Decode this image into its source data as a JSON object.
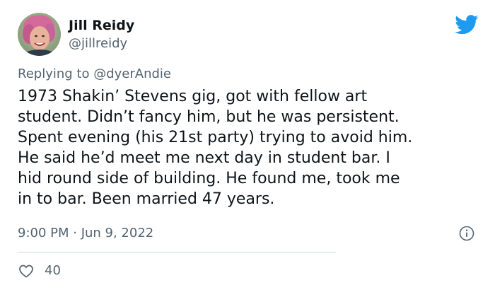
{
  "author": {
    "display_name": "Jill Reidy",
    "handle": "@jillreidy",
    "avatar_icon": "profile-photo-avatar"
  },
  "brand": {
    "logo_icon": "twitter-bird-icon",
    "color": "#1d9bf0"
  },
  "reply_context": {
    "prefix": "Replying to",
    "mention": "@dyerAndie"
  },
  "tweet": {
    "text_lines": [
      "1973 Shakin’ Stevens gig, got with fellow art",
      "student. Didn’t fancy him, but he was persistent.",
      "Spent evening (his 21st party) trying to avoid him.",
      "He said he’d meet me next day in student bar. I",
      "hid round side of building. He found me, took me",
      "in to bar. Been married 47 years."
    ],
    "timestamp": "9:00 PM · Jun 9, 2022"
  },
  "actions": {
    "like_icon": "heart-icon",
    "like_count": "40",
    "info_icon": "info-icon"
  },
  "colors": {
    "text_primary": "#0f1419",
    "text_secondary": "#536471",
    "divider": "#cfd9de"
  }
}
